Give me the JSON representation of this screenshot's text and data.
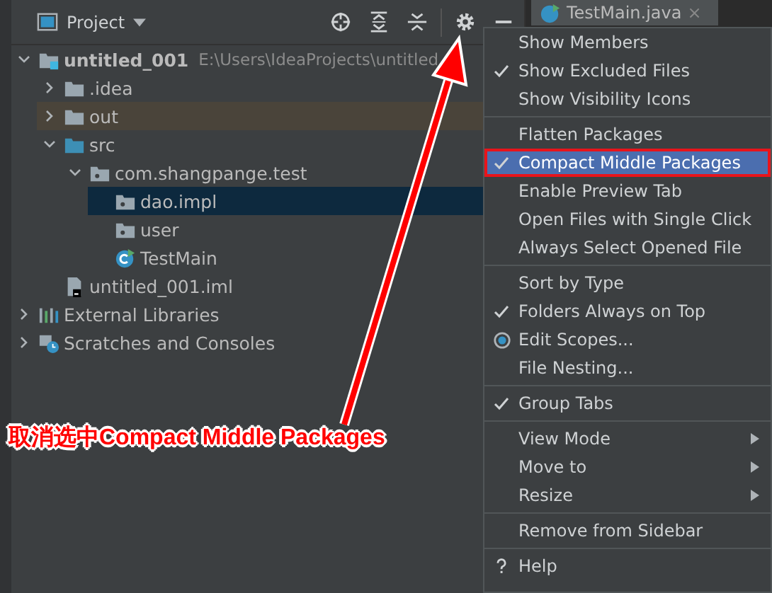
{
  "panel": {
    "title": "Project"
  },
  "editor_tab": {
    "label": "TestMain.java",
    "close": "×"
  },
  "tree": [
    {
      "label": "untitled_001",
      "hint": "E:\\Users\\IdeaProjects\\untitled",
      "kind": "module",
      "expanded": true,
      "selected": false,
      "excluded": false,
      "children": [
        {
          "label": ".idea",
          "kind": "folder",
          "expanded": false,
          "selected": false,
          "excluded": false
        },
        {
          "label": "out",
          "kind": "folder",
          "expanded": false,
          "selected": false,
          "excluded": true
        },
        {
          "label": "src",
          "kind": "source",
          "expanded": true,
          "selected": false,
          "excluded": false,
          "children": [
            {
              "label": "com.shangpange.test",
              "kind": "package",
              "expanded": true,
              "selected": false,
              "excluded": false,
              "children": [
                {
                  "label": "dao.impl",
                  "kind": "package",
                  "selected": true,
                  "excluded": false
                },
                {
                  "label": "user",
                  "kind": "package",
                  "selected": false,
                  "excluded": false
                },
                {
                  "label": "TestMain",
                  "kind": "class",
                  "selected": false,
                  "excluded": false
                }
              ]
            }
          ]
        },
        {
          "label": "untitled_001.iml",
          "kind": "file",
          "selected": false,
          "excluded": false
        }
      ]
    },
    {
      "label": "External Libraries",
      "kind": "libraries",
      "expanded": false,
      "selected": false,
      "excluded": false
    },
    {
      "label": "Scratches and Consoles",
      "kind": "scratches",
      "expanded": false,
      "selected": false,
      "excluded": false
    }
  ],
  "menu": [
    [
      {
        "label": "Show Members",
        "kind": "check",
        "checked": false,
        "selected": false
      },
      {
        "label": "Show Excluded Files",
        "kind": "check",
        "checked": true,
        "selected": false
      },
      {
        "label": "Show Visibility Icons",
        "kind": "check",
        "checked": false,
        "selected": false
      }
    ],
    [
      {
        "label": "Flatten Packages",
        "kind": "check",
        "checked": false,
        "selected": false
      },
      {
        "label": "Compact Middle Packages",
        "kind": "check",
        "checked": true,
        "selected": true
      },
      {
        "label": "Enable Preview Tab",
        "kind": "check",
        "checked": false,
        "selected": false
      },
      {
        "label": "Open Files with Single Click",
        "kind": "check",
        "checked": false,
        "selected": false
      },
      {
        "label": "Always Select Opened File",
        "kind": "check",
        "checked": false,
        "selected": false
      }
    ],
    [
      {
        "label": "Sort by Type",
        "kind": "check",
        "checked": false,
        "selected": false
      },
      {
        "label": "Folders Always on Top",
        "kind": "check",
        "checked": true,
        "selected": false
      },
      {
        "label": "Edit Scopes...",
        "kind": "radio",
        "checked": true,
        "selected": false
      },
      {
        "label": "File Nesting...",
        "kind": "check",
        "checked": false,
        "selected": false
      }
    ],
    [
      {
        "label": "Group Tabs",
        "kind": "check",
        "checked": true,
        "selected": false
      }
    ],
    [
      {
        "label": "View Mode",
        "kind": "submenu",
        "selected": false
      },
      {
        "label": "Move to",
        "kind": "submenu",
        "selected": false
      },
      {
        "label": "Resize",
        "kind": "submenu",
        "selected": false
      }
    ],
    [
      {
        "label": "Remove from Sidebar",
        "kind": "plain",
        "selected": false
      }
    ],
    [
      {
        "label": "Help",
        "kind": "help",
        "selected": false
      }
    ]
  ],
  "annotation": {
    "text": "取消选中Compact Middle Packages"
  }
}
